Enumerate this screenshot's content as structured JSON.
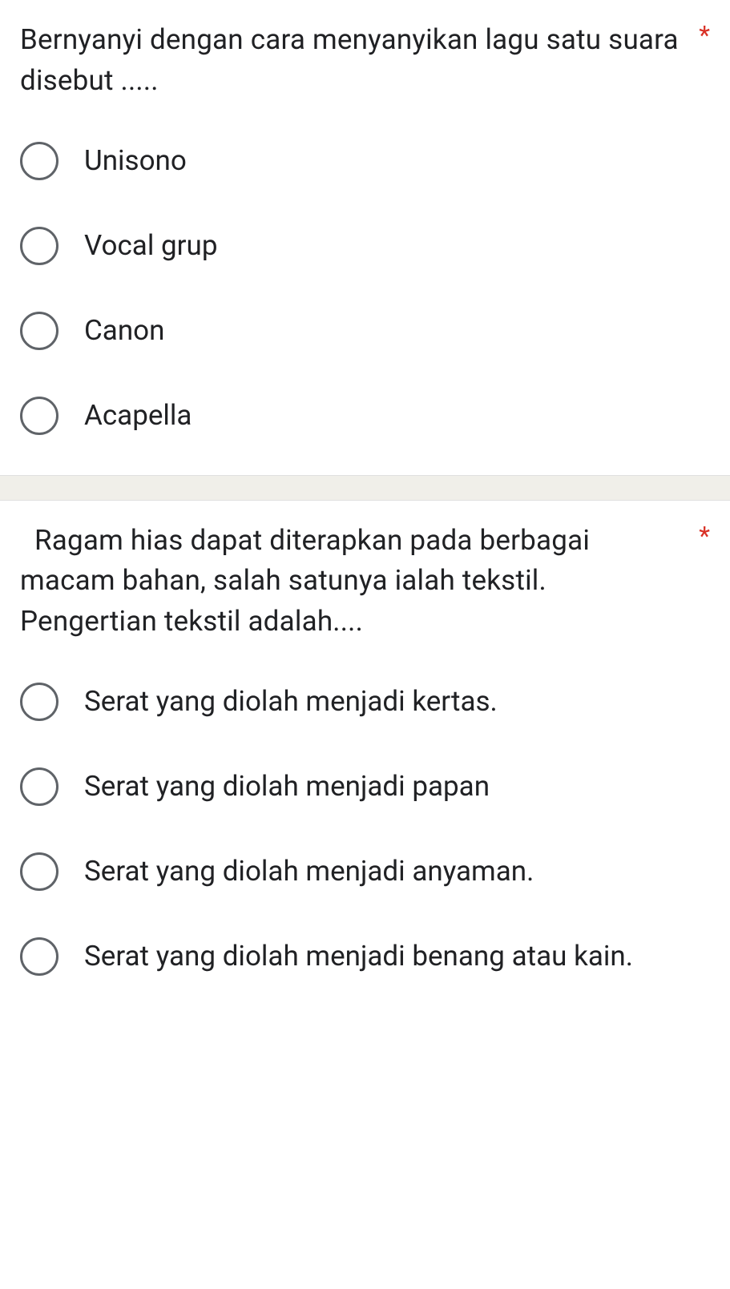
{
  "questions": [
    {
      "text": "Bernyanyi dengan cara menyanyikan lagu satu suara disebut .....",
      "required": "*",
      "options": [
        "Unisono",
        "Vocal grup",
        "Canon",
        "Acapella"
      ]
    },
    {
      "text": "Ragam hias dapat diterapkan pada berbagai macam bahan, salah satunya ialah tekstil. Pengertian tekstil adalah....",
      "required": "*",
      "options": [
        "Serat yang diolah menjadi kertas.",
        "Serat yang diolah menjadi papan",
        "Serat yang diolah menjadi anyaman.",
        "Serat yang diolah menjadi benang atau kain."
      ]
    }
  ]
}
